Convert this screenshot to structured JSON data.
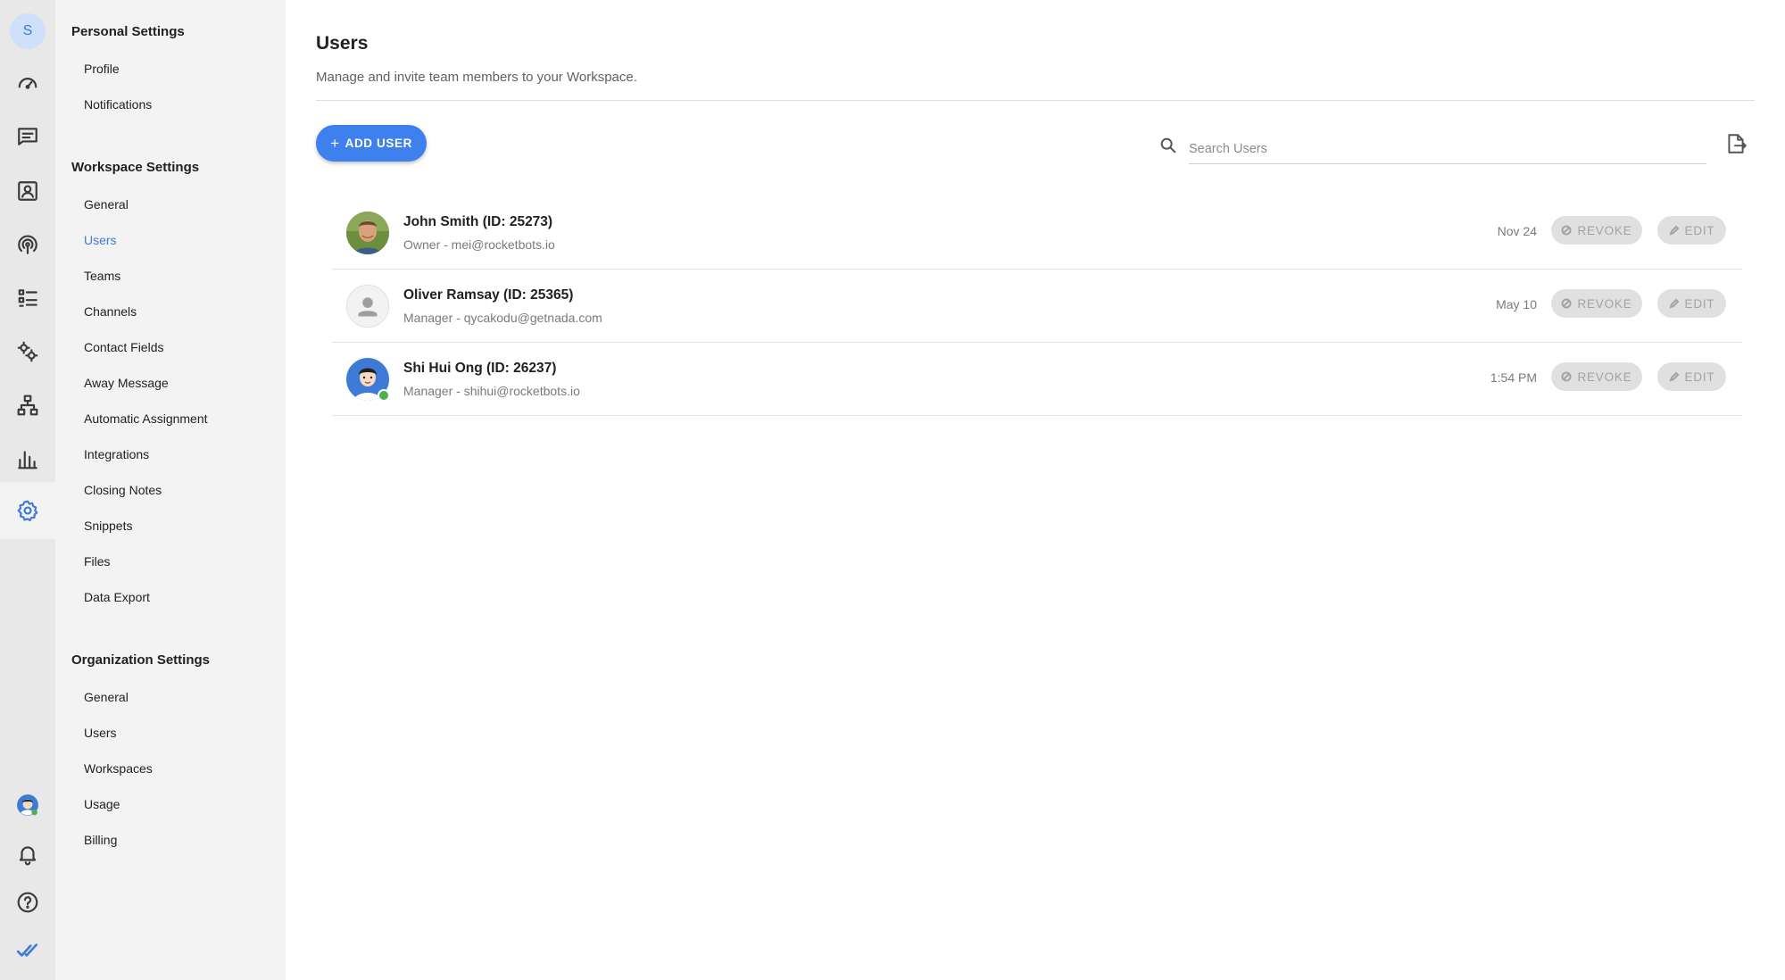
{
  "rail": {
    "workspace_initial": "S",
    "items": [
      {
        "icon": "dashboard-gauge-icon"
      },
      {
        "icon": "messages-icon"
      },
      {
        "icon": "contacts-icon"
      },
      {
        "icon": "broadcast-icon"
      },
      {
        "icon": "list-icon"
      },
      {
        "icon": "automation-gears-icon"
      },
      {
        "icon": "workflow-icon"
      },
      {
        "icon": "reports-bar-chart-icon"
      },
      {
        "icon": "settings-gear-icon",
        "active": true
      }
    ],
    "bottom": [
      {
        "icon": "user-avatar-icon"
      },
      {
        "icon": "notifications-bell-icon"
      },
      {
        "icon": "help-question-icon"
      },
      {
        "icon": "double-check-logo-icon"
      }
    ]
  },
  "sidebar": {
    "personal_title": "Personal Settings",
    "personal_items": [
      "Profile",
      "Notifications"
    ],
    "workspace_title": "Workspace Settings",
    "workspace_items": [
      "General",
      "Users",
      "Teams",
      "Channels",
      "Contact Fields",
      "Away Message",
      "Automatic Assignment",
      "Integrations",
      "Closing Notes",
      "Snippets",
      "Files",
      "Data Export"
    ],
    "organization_title": "Organization Settings",
    "organization_items": [
      "General",
      "Users",
      "Workspaces",
      "Usage",
      "Billing"
    ]
  },
  "main": {
    "title": "Users",
    "subtitle": "Manage and invite team members to your Workspace.",
    "add_user_label": "ADD USER",
    "search_placeholder": "Search Users",
    "users": [
      {
        "name": "John Smith (ID: 25273)",
        "sub": "Owner - mei@rocketbots.io",
        "date": "Nov 24",
        "revoke": "REVOKE",
        "edit": "EDIT"
      },
      {
        "name": "Oliver Ramsay (ID: 25365)",
        "sub": "Manager - qycakodu@getnada.com",
        "date": "May 10",
        "revoke": "REVOKE",
        "edit": "EDIT"
      },
      {
        "name": "Shi Hui Ong (ID: 26237)",
        "sub": "Manager - shihui@rocketbots.io",
        "date": "1:54 PM",
        "revoke": "REVOKE",
        "edit": "EDIT"
      }
    ]
  },
  "colors": {
    "accent": "#3e80ee",
    "active_nav": "#3e7bd6",
    "online": "#4caf50"
  }
}
